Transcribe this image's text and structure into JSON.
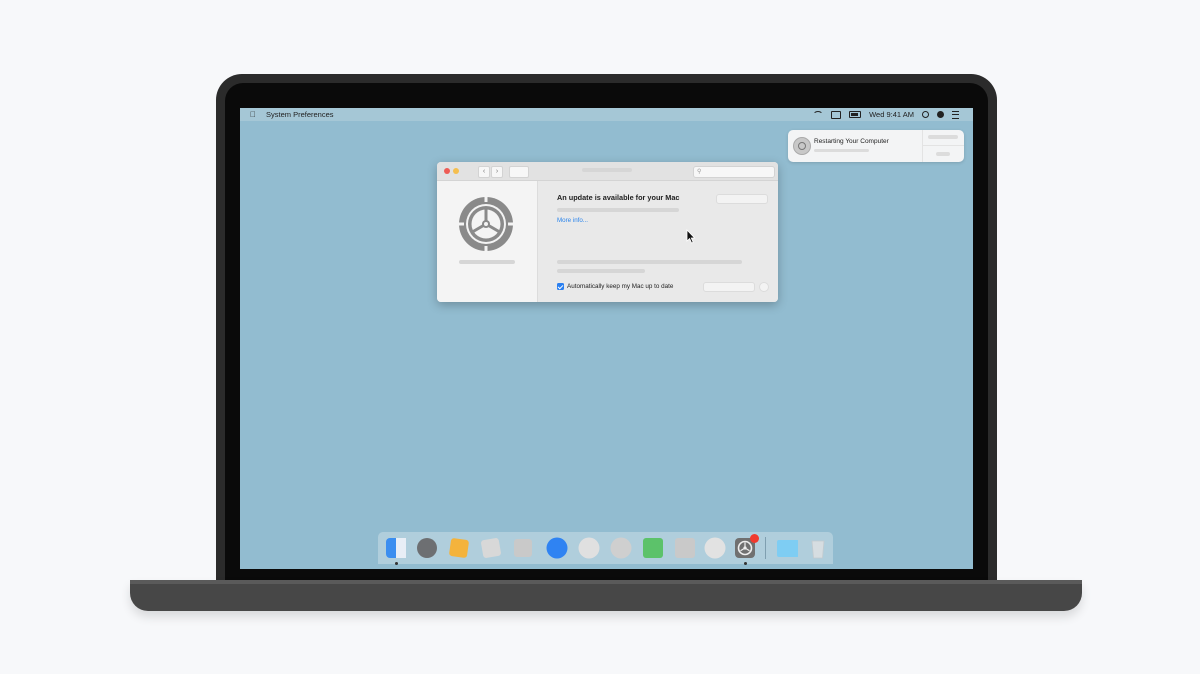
{
  "menubar": {
    "app_name": "System Preferences",
    "clock": "Wed 9:41 AM",
    "icons": [
      "apple-icon",
      "wifi-icon",
      "airplay-icon",
      "battery-icon",
      "spotlight-icon",
      "siri-icon",
      "control-center-icon"
    ]
  },
  "notification": {
    "title": "Restarting Your Computer",
    "icon": "software-update-icon"
  },
  "window": {
    "heading": "An update is available for your Mac",
    "more_info": "More info...",
    "auto_update_label": "Automatically keep my Mac up to date",
    "auto_update_checked": true
  },
  "dock": {
    "items": [
      {
        "name": "finder",
        "color": "#3b8ef0"
      },
      {
        "name": "launchpad",
        "color": "#6d6f72"
      },
      {
        "name": "notes",
        "color": "#f4b33c"
      },
      {
        "name": "app-gray-1",
        "color": "#d8d8d8"
      },
      {
        "name": "app-gray-2",
        "color": "#c9c9c9"
      },
      {
        "name": "app-blue",
        "color": "#2f83f2"
      },
      {
        "name": "app-light-1",
        "color": "#e0e0e0"
      },
      {
        "name": "app-light-2",
        "color": "#cfcfcf"
      },
      {
        "name": "app-green",
        "color": "#5cc26a"
      },
      {
        "name": "app-gray-3",
        "color": "#c9c9c9"
      },
      {
        "name": "app-light-3",
        "color": "#e2e2e2"
      },
      {
        "name": "system-preferences",
        "color": "#707070",
        "badge": true
      },
      {
        "name": "folder",
        "color": "#7ecdf3"
      },
      {
        "name": "trash",
        "color": "#d6dde1"
      }
    ]
  },
  "colors": {
    "desktop": "#92bcd0",
    "accent": "#2a7ff0",
    "close": "#ee5c55",
    "minimize": "#f5bf4f",
    "badge": "#f03a2e"
  }
}
